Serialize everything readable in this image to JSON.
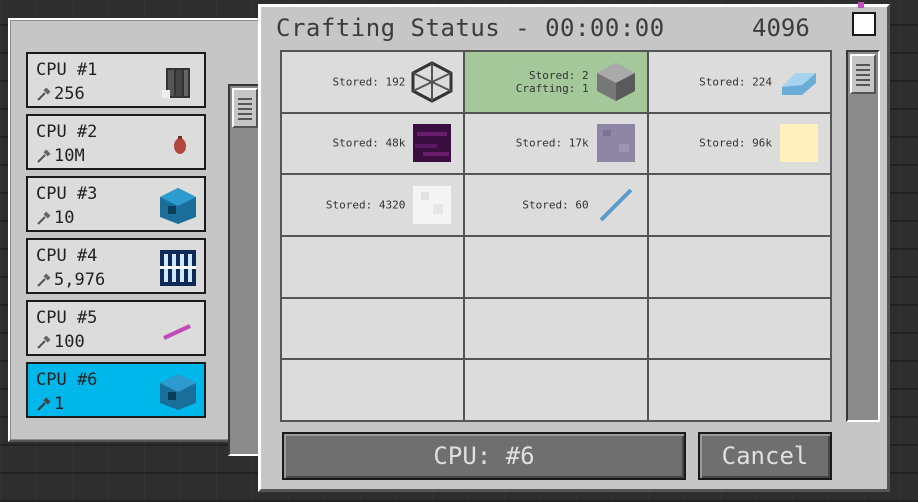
{
  "header": {
    "title": "Crafting Status - 00:00:00",
    "count": "4096"
  },
  "cpus": [
    {
      "name": "CPU #1",
      "count": "256",
      "icon": "server-rack-icon"
    },
    {
      "name": "CPU #2",
      "count": "10M",
      "icon": "red-seed-icon"
    },
    {
      "name": "CPU #3",
      "count": "10",
      "icon": "blue-crafting-unit-icon"
    },
    {
      "name": "CPU #4",
      "count": "5,976",
      "icon": "storage-grid-icon"
    },
    {
      "name": "CPU #5",
      "count": "100",
      "icon": "pink-rod-icon"
    },
    {
      "name": "CPU #6",
      "count": "1",
      "icon": "blue-crafting-unit-icon"
    }
  ],
  "items": [
    {
      "line1": "Stored: 192",
      "line2": "",
      "icon": "frame-block-icon"
    },
    {
      "line1": "Stored: 2",
      "line2": "Crafting: 1",
      "icon": "stone-block-icon"
    },
    {
      "line1": "Stored: 224",
      "line2": "",
      "icon": "blue-crystal-icon"
    },
    {
      "line1": "Stored: 48k",
      "line2": "",
      "icon": "purple-block-icon"
    },
    {
      "line1": "Stored: 17k",
      "line2": "",
      "icon": "lavender-block-icon"
    },
    {
      "line1": "Stored: 96k",
      "line2": "",
      "icon": "cream-block-icon"
    },
    {
      "line1": "Stored: 4320",
      "line2": "",
      "icon": "white-quartz-icon"
    },
    {
      "line1": "Stored: 60",
      "line2": "",
      "icon": "blue-rod-icon"
    }
  ],
  "buttons": {
    "cpu_label": "CPU: #6",
    "cancel_label": "Cancel"
  },
  "colors": {
    "selected_cpu": "#00b7ec",
    "crafting_cell": "#a4c89a"
  }
}
